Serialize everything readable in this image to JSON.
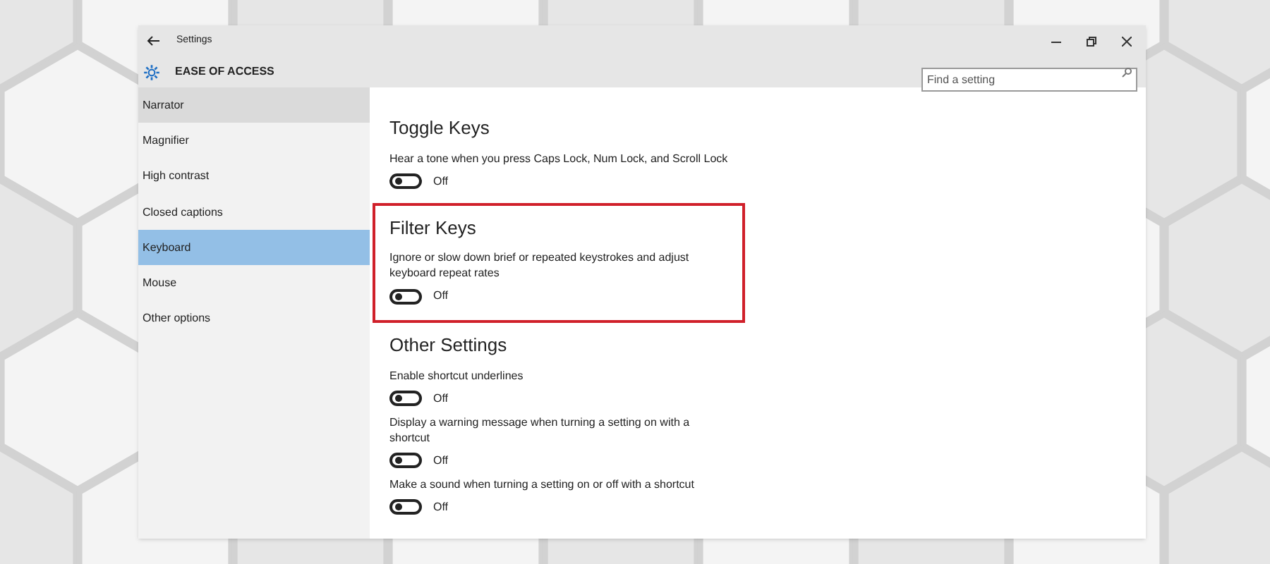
{
  "window": {
    "title": "Settings"
  },
  "header": {
    "title": "EASE OF ACCESS"
  },
  "search": {
    "placeholder": "Find a setting"
  },
  "sidebar": {
    "items": [
      {
        "label": "Narrator",
        "selected": false,
        "hovered": true
      },
      {
        "label": "Magnifier",
        "selected": false,
        "hovered": false
      },
      {
        "label": "High contrast",
        "selected": false,
        "hovered": false
      },
      {
        "label": "Closed captions",
        "selected": false,
        "hovered": false
      },
      {
        "label": "Keyboard",
        "selected": true,
        "hovered": false
      },
      {
        "label": "Mouse",
        "selected": false,
        "hovered": false
      },
      {
        "label": "Other options",
        "selected": false,
        "hovered": false
      }
    ]
  },
  "sections": [
    {
      "title": "Toggle Keys",
      "highlighted": false,
      "settings": [
        {
          "label": "Hear a tone when you press Caps Lock, Num Lock, and Scroll Lock",
          "on": false,
          "state": "Off"
        }
      ]
    },
    {
      "title": "Filter Keys",
      "highlighted": true,
      "settings": [
        {
          "label": "Ignore or slow down brief or repeated keystrokes and adjust keyboard repeat rates",
          "on": false,
          "state": "Off"
        }
      ]
    },
    {
      "title": "Other Settings",
      "highlighted": false,
      "settings": [
        {
          "label": "Enable shortcut underlines",
          "on": false,
          "state": "Off"
        },
        {
          "label": "Display a warning message when turning a setting on with a shortcut",
          "on": false,
          "state": "Off"
        },
        {
          "label": "Make a sound when turning a setting on or off with a shortcut",
          "on": false,
          "state": "Off"
        }
      ]
    }
  ]
}
